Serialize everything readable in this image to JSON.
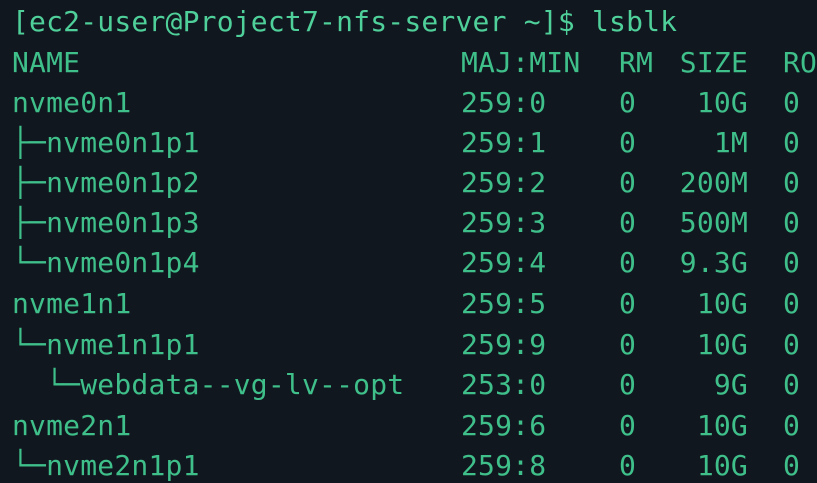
{
  "terminal": {
    "prompt": "[ec2-user@Project7-nfs-server ~]$ lsblk",
    "header": {
      "name": "NAME",
      "majmin": "MAJ:MIN",
      "rm": "RM",
      "size": "SIZE",
      "ro": "RO"
    },
    "rows": [
      {
        "name": "nvme0n1",
        "majmin": "259:0",
        "rm": "0",
        "size": "10G",
        "ro": "0"
      },
      {
        "name": "├─nvme0n1p1",
        "majmin": "259:1",
        "rm": "0",
        "size": "1M",
        "ro": "0"
      },
      {
        "name": "├─nvme0n1p2",
        "majmin": "259:2",
        "rm": "0",
        "size": "200M",
        "ro": "0"
      },
      {
        "name": "├─nvme0n1p3",
        "majmin": "259:3",
        "rm": "0",
        "size": "500M",
        "ro": "0"
      },
      {
        "name": "└─nvme0n1p4",
        "majmin": "259:4",
        "rm": "0",
        "size": "9.3G",
        "ro": "0"
      },
      {
        "name": "nvme1n1",
        "majmin": "259:5",
        "rm": "0",
        "size": "10G",
        "ro": "0"
      },
      {
        "name": "└─nvme1n1p1",
        "majmin": "259:9",
        "rm": "0",
        "size": "10G",
        "ro": "0"
      },
      {
        "name": "  └─webdata--vg-lv--opt",
        "majmin": "253:0",
        "rm": "0",
        "size": "9G",
        "ro": "0"
      },
      {
        "name": "nvme2n1",
        "majmin": "259:6",
        "rm": "0",
        "size": "10G",
        "ro": "0"
      },
      {
        "name": "└─nvme2n1p1",
        "majmin": "259:8",
        "rm": "0",
        "size": "10G",
        "ro": "0"
      }
    ],
    "colors": {
      "background": "#11171f",
      "text": "#3fbf8a"
    }
  }
}
